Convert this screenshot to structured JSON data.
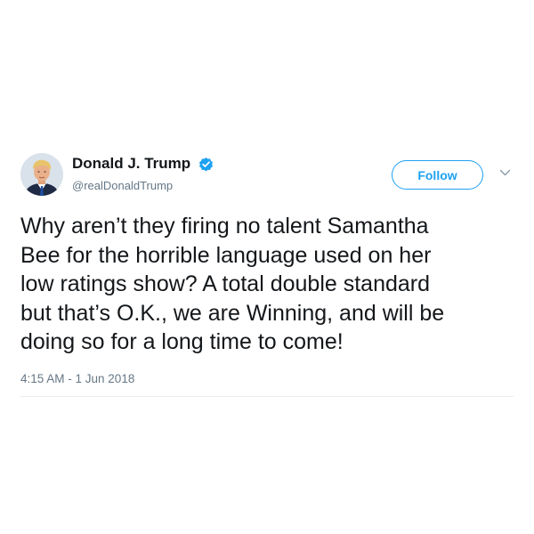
{
  "tweet": {
    "author": {
      "display_name": "Donald J. Trump",
      "handle": "@realDonaldTrump",
      "verified": true,
      "avatar_icon": "profile-photo"
    },
    "follow_label": "Follow",
    "more_menu_icon": "chevron-down-icon",
    "text": "Why aren’t they firing no talent Samantha\nBee for the horrible language used on her\nlow ratings show? A total double standard\nbut that’s O.K., we are Winning, and will be\ndoing so for a long time to come!",
    "timestamp": "4:15 AM - 1 Jun 2018"
  },
  "colors": {
    "accent": "#1da1f2",
    "text_primary": "#14171a",
    "text_secondary": "#657786",
    "divider": "#e6ecf0"
  }
}
